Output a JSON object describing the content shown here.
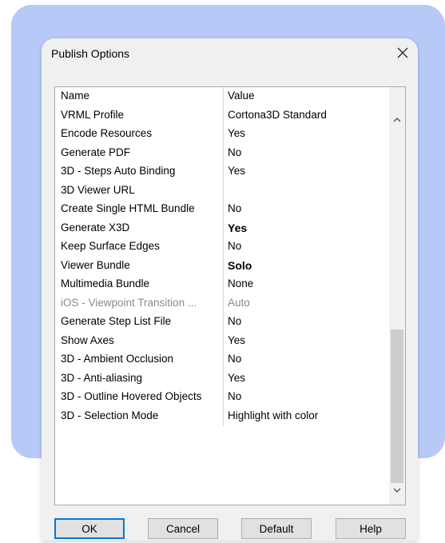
{
  "dialog": {
    "title": "Publish Options",
    "close_glyph": "✕"
  },
  "table": {
    "headers": {
      "name": "Name",
      "value": "Value"
    },
    "rows": [
      {
        "name": "VRML Profile",
        "value": "Cortona3D Standard"
      },
      {
        "name": "Encode Resources",
        "value": "Yes"
      },
      {
        "name": "Generate PDF",
        "value": "No"
      },
      {
        "name": "3D - Steps Auto Binding",
        "value": "Yes"
      },
      {
        "name": "3D Viewer URL",
        "value": ""
      },
      {
        "name": "Create Single HTML Bundle",
        "value": "No"
      },
      {
        "name": "Generate X3D",
        "value": "Yes"
      },
      {
        "name": "Keep Surface Edges",
        "value": "No"
      },
      {
        "name": "Viewer Bundle",
        "value": "Solo"
      },
      {
        "name": "Multimedia Bundle",
        "value": "None"
      },
      {
        "name": "iOS - Viewpoint Transition ...",
        "value": "Auto"
      },
      {
        "name": "Generate Step List File",
        "value": "No"
      },
      {
        "name": "Show Axes",
        "value": "Yes"
      },
      {
        "name": "3D - Ambient Occlusion",
        "value": "No"
      },
      {
        "name": "3D - Anti-aliasing",
        "value": "Yes"
      },
      {
        "name": "3D - Outline Hovered Objects",
        "value": "No"
      },
      {
        "name": "3D - Selection Mode",
        "value": "Highlight with color"
      }
    ]
  },
  "scrollbar": {
    "up_icon": "chevron-up-icon",
    "down_icon": "chevron-down-icon"
  },
  "buttons": {
    "ok": "OK",
    "cancel": "Cancel",
    "default": "Default",
    "help": "Help"
  },
  "colors": {
    "background_card": "#b7c9f7",
    "focus_border": "#0078d7"
  }
}
